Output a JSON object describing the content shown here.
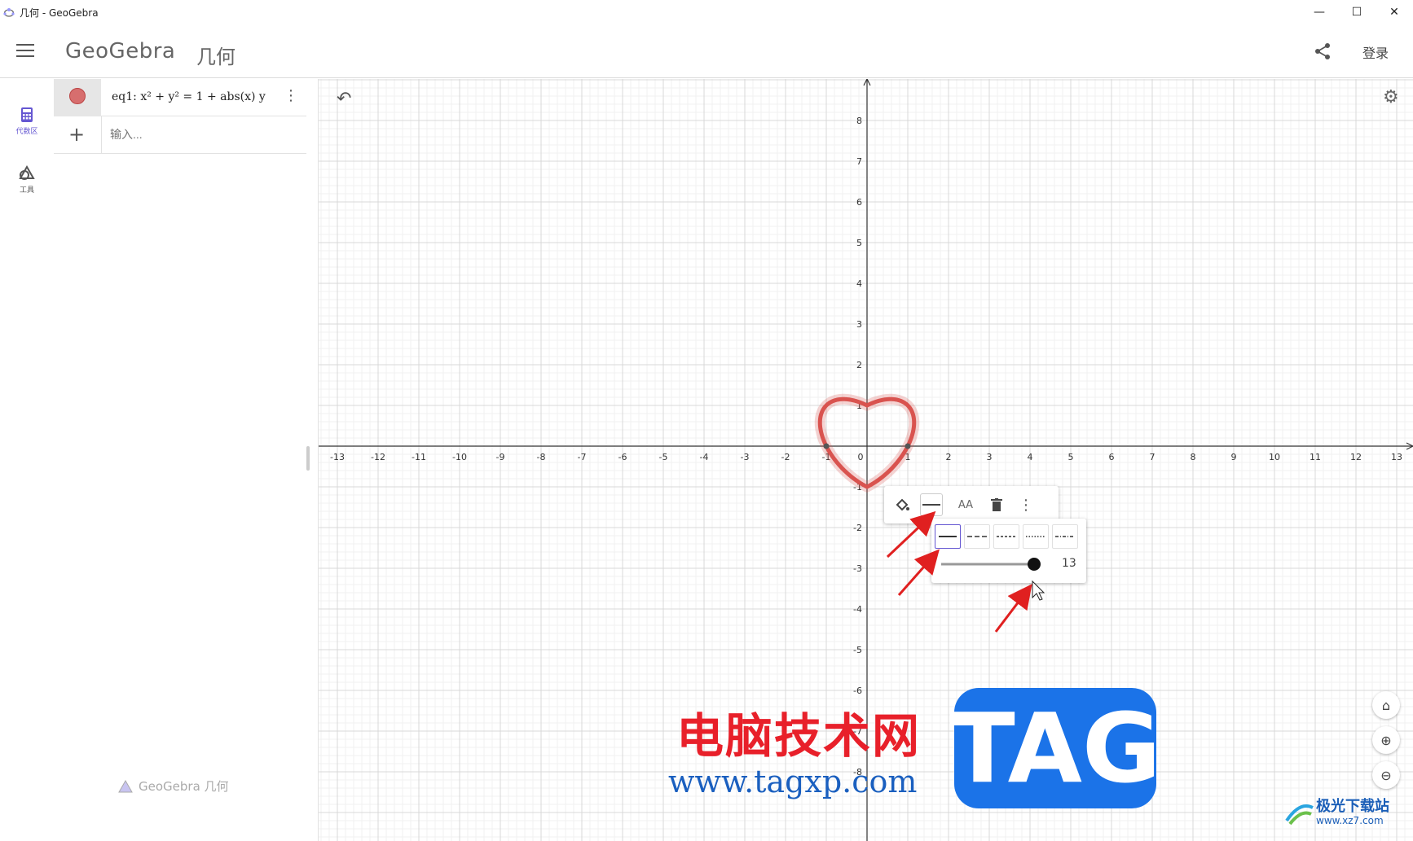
{
  "window": {
    "title": "几何 - GeoGebra",
    "minimize": "—",
    "maximize": "☐",
    "close": "✕"
  },
  "header": {
    "logo": "GeoGebra",
    "app_name": "几何",
    "login": "登录"
  },
  "sidebar": {
    "items": [
      {
        "label": "代数区",
        "icon": "calculator-icon"
      },
      {
        "label": "工具",
        "icon": "tools-icon"
      }
    ]
  },
  "algebra": {
    "entry_label": "eq1: x² + y² = 1 + abs(x) y",
    "input_placeholder": "输入...",
    "footer": "GeoGebra 几何",
    "marble_color": "#d76e6e"
  },
  "graph": {
    "x_ticks": [
      "-13",
      "-12",
      "-11",
      "-10",
      "-9",
      "-8",
      "-7",
      "-6",
      "-5",
      "-4",
      "-3",
      "-2",
      "-1",
      "0",
      "1",
      "2",
      "3",
      "4",
      "5",
      "6",
      "7",
      "8",
      "9",
      "10",
      "11",
      "12",
      "13"
    ],
    "y_ticks_pos": [
      "8",
      "7",
      "6",
      "5",
      "4",
      "3",
      "2",
      "1"
    ],
    "y_ticks_neg": [
      "-1",
      "-2",
      "-3",
      "-4",
      "-5",
      "-6",
      "-7",
      "-8"
    ],
    "curve_color": "#d9534f"
  },
  "style_bar": {
    "buttons": [
      "color-fill-icon",
      "line-style-icon",
      "label-style-icon",
      "delete-icon",
      "more-icon"
    ],
    "label_text": "AA",
    "line_thickness": "13",
    "line_styles": [
      "solid",
      "dashed-long",
      "dashed-short",
      "dotted",
      "dash-dot"
    ]
  },
  "watermark": {
    "cn_text": "电脑技术网",
    "url": "www.tagxp.com",
    "tag": "TAG",
    "corner_title": "极光下载站",
    "corner_url": "www.xz7.com"
  }
}
